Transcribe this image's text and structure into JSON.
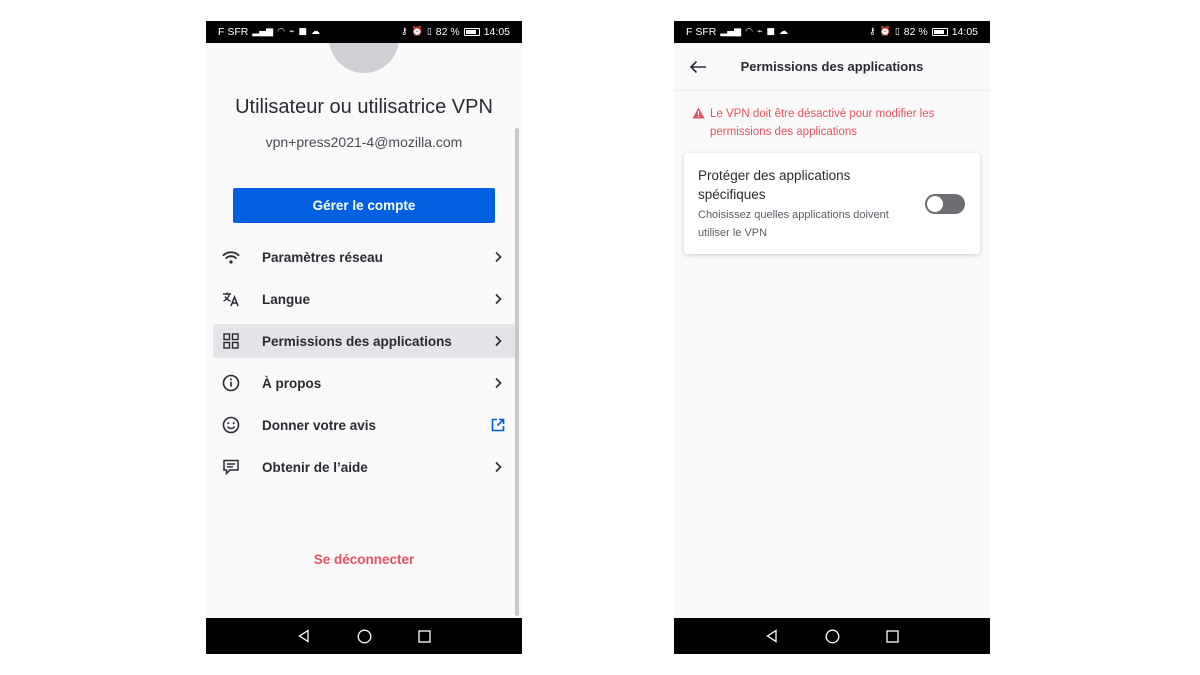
{
  "status_bar": {
    "carrier": "F SFR",
    "battery_percent": "82 %",
    "time": "14:05"
  },
  "left_screen": {
    "profile": {
      "name": "Utilisateur ou utilisatrice VPN",
      "email": "vpn+press2021-4@mozilla.com"
    },
    "manage_button": "Gérer le compte",
    "menu": [
      {
        "label": "Paramètres réseau",
        "icon": "wifi-icon",
        "trailing": "chevron-right-icon"
      },
      {
        "label": "Langue",
        "icon": "translate-icon",
        "trailing": "chevron-right-icon"
      },
      {
        "label": "Permissions des applications",
        "icon": "apps-grid-icon",
        "trailing": "chevron-right-icon",
        "active": true
      },
      {
        "label": "À propos",
        "icon": "info-icon",
        "trailing": "chevron-right-icon"
      },
      {
        "label": "Donner votre avis",
        "icon": "smiley-icon",
        "trailing": "external-link-icon"
      },
      {
        "label": "Obtenir de l’aide",
        "icon": "help-chat-icon",
        "trailing": "chevron-right-icon"
      }
    ],
    "signout": "Se déconnecter"
  },
  "right_screen": {
    "title": "Permissions des applications",
    "warning": "Le VPN doit être désactivé pour modifier les permissions des applications",
    "setting": {
      "title": "Protéger des applications spécifiques",
      "description": "Choisissez quelles applications doivent utiliser le VPN",
      "toggle_on": false
    }
  },
  "colors": {
    "accent_blue": "#0060df",
    "warning_red": "#e25563",
    "background": "#f9f9fa"
  }
}
